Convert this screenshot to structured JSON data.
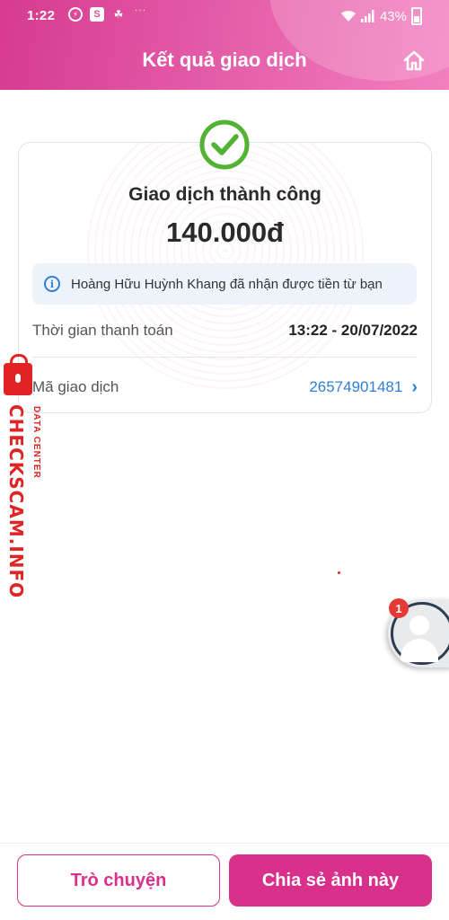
{
  "status_bar": {
    "time": "1:22",
    "notification_icons": [
      "messenger-icon",
      "shopee-icon",
      "app-icon"
    ],
    "more": "···",
    "battery_percent": "43%"
  },
  "header": {
    "title": "Kết quả giao dịch",
    "home_icon": "home-icon",
    "gradient_start": "#d63a8e",
    "gradient_end": "#f27fc0"
  },
  "result": {
    "status_icon": "check-circle-icon",
    "status_color": "#52b332",
    "status_text": "Giao dịch thành công",
    "amount": "140.000đ",
    "info_icon": "info-icon",
    "info_message": "Hoàng Hữu Huỳnh Khang đã nhận được tiền từ bạn",
    "details": {
      "payment_time_label": "Thời gian thanh toán",
      "payment_time_value": "13:22 - 20/07/2022",
      "transaction_id_label": "Mã giao dịch",
      "transaction_id_value": "26574901481",
      "link_color": "#2f7fd8"
    }
  },
  "watermark": {
    "main": "CHECKSCAM.INFO",
    "sub": "DATA CENTER",
    "color": "#e02424"
  },
  "chat_head": {
    "badge_count": "1"
  },
  "actions": {
    "chat_label": "Trò chuyện",
    "share_label": "Chia sẻ ảnh này",
    "accent": "#d9308c"
  }
}
